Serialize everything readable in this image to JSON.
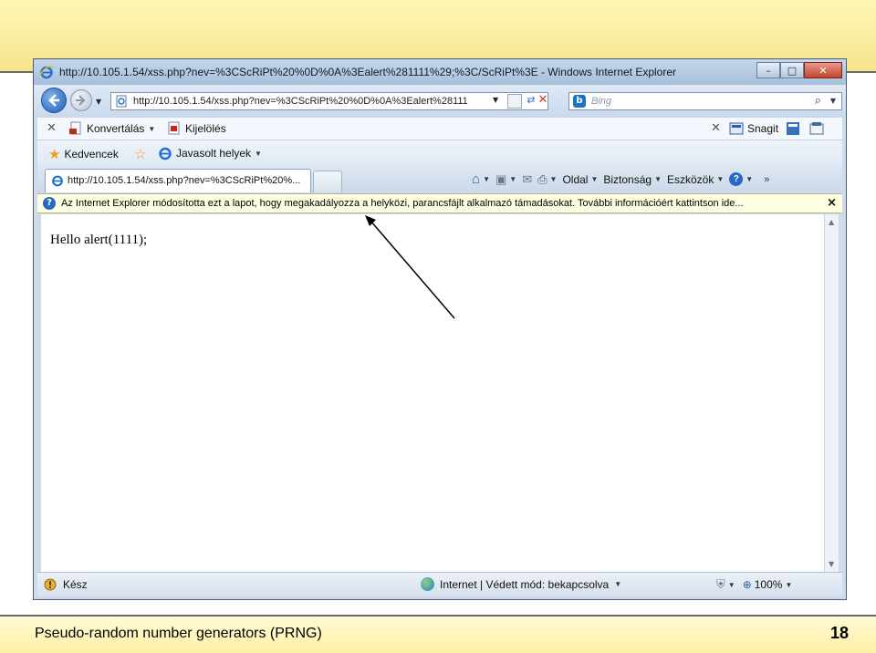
{
  "slide": {
    "footer_title": "Pseudo-random number generators (PRNG)",
    "page_number": "18",
    "top_bg_color": "#f7e78f"
  },
  "window": {
    "title": "http://10.105.1.54/xss.php?nev=%3CScRiPt%20%0D%0A%3Ealert%281111%29;%3C/ScRiPt%3E - Windows Internet Explorer",
    "buttons": {
      "minimize": "–",
      "maximize": "□",
      "close": "✕"
    }
  },
  "nav": {
    "address": "http://10.105.1.54/xss.php?nev=%3CScRiPt%20%0D%0A%3Ealert%28111",
    "search_placeholder": "Bing",
    "search_icon": "magnifier-icon"
  },
  "command_bar": {
    "close": "✕",
    "convert_label": "Konvertálás",
    "select_label": "Kijelölés",
    "snagit_close": "✕",
    "snagit_label": "Snagit"
  },
  "favorites": {
    "favorites_label": "Kedvencek",
    "suggested_label": "Javasolt helyek"
  },
  "tab": {
    "title": "http://10.105.1.54/xss.php?nev=%3CScRiPt%20%..."
  },
  "toolbar": {
    "page_label": "Oldal",
    "safety_label": "Biztonság",
    "tools_label": "Eszközök",
    "help_label": "?",
    "more": "»"
  },
  "infobar": {
    "message": "Az Internet Explorer módosította ezt a lapot, hogy megakadályozza a helyközi, parancsfájlt alkalmazó támadásokat. További információért kattintson ide...",
    "close": "×"
  },
  "content": {
    "text": "Hello alert(1111);"
  },
  "status": {
    "state": "Kész",
    "zone": "Internet | Védett mód: bekapcsolva",
    "zoom": "100%"
  },
  "colors": {
    "accent": "#1f5fb8",
    "infobar_bg": "#ffffe1",
    "close_button": "#c2452f"
  }
}
